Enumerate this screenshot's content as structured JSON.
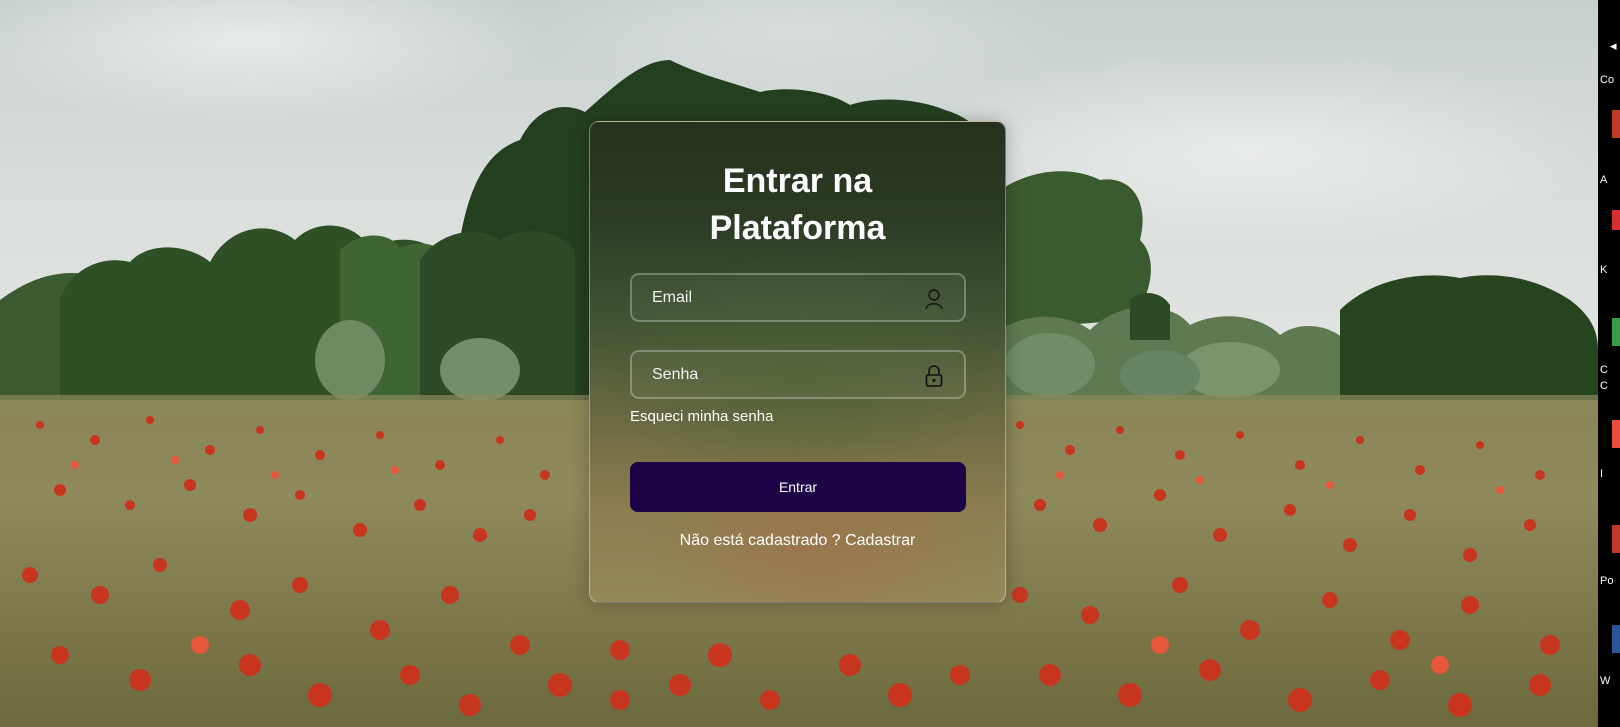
{
  "login": {
    "title_line1": "Entrar na",
    "title_line2": "Plataforma",
    "email_placeholder": "Email",
    "password_placeholder": "Senha",
    "forgot_password": "Esqueci minha senha",
    "submit_label": "Entrar",
    "register_text": "Não está cadastrado ? Cadastrar"
  },
  "desktop": {
    "labels": [
      "Co",
      "A",
      "K",
      "C",
      "C",
      "I",
      "Po",
      "W"
    ]
  },
  "colors": {
    "button_bg": "#1b0346",
    "text": "#ffffff"
  },
  "icons": [
    "user-icon",
    "lock-icon"
  ]
}
